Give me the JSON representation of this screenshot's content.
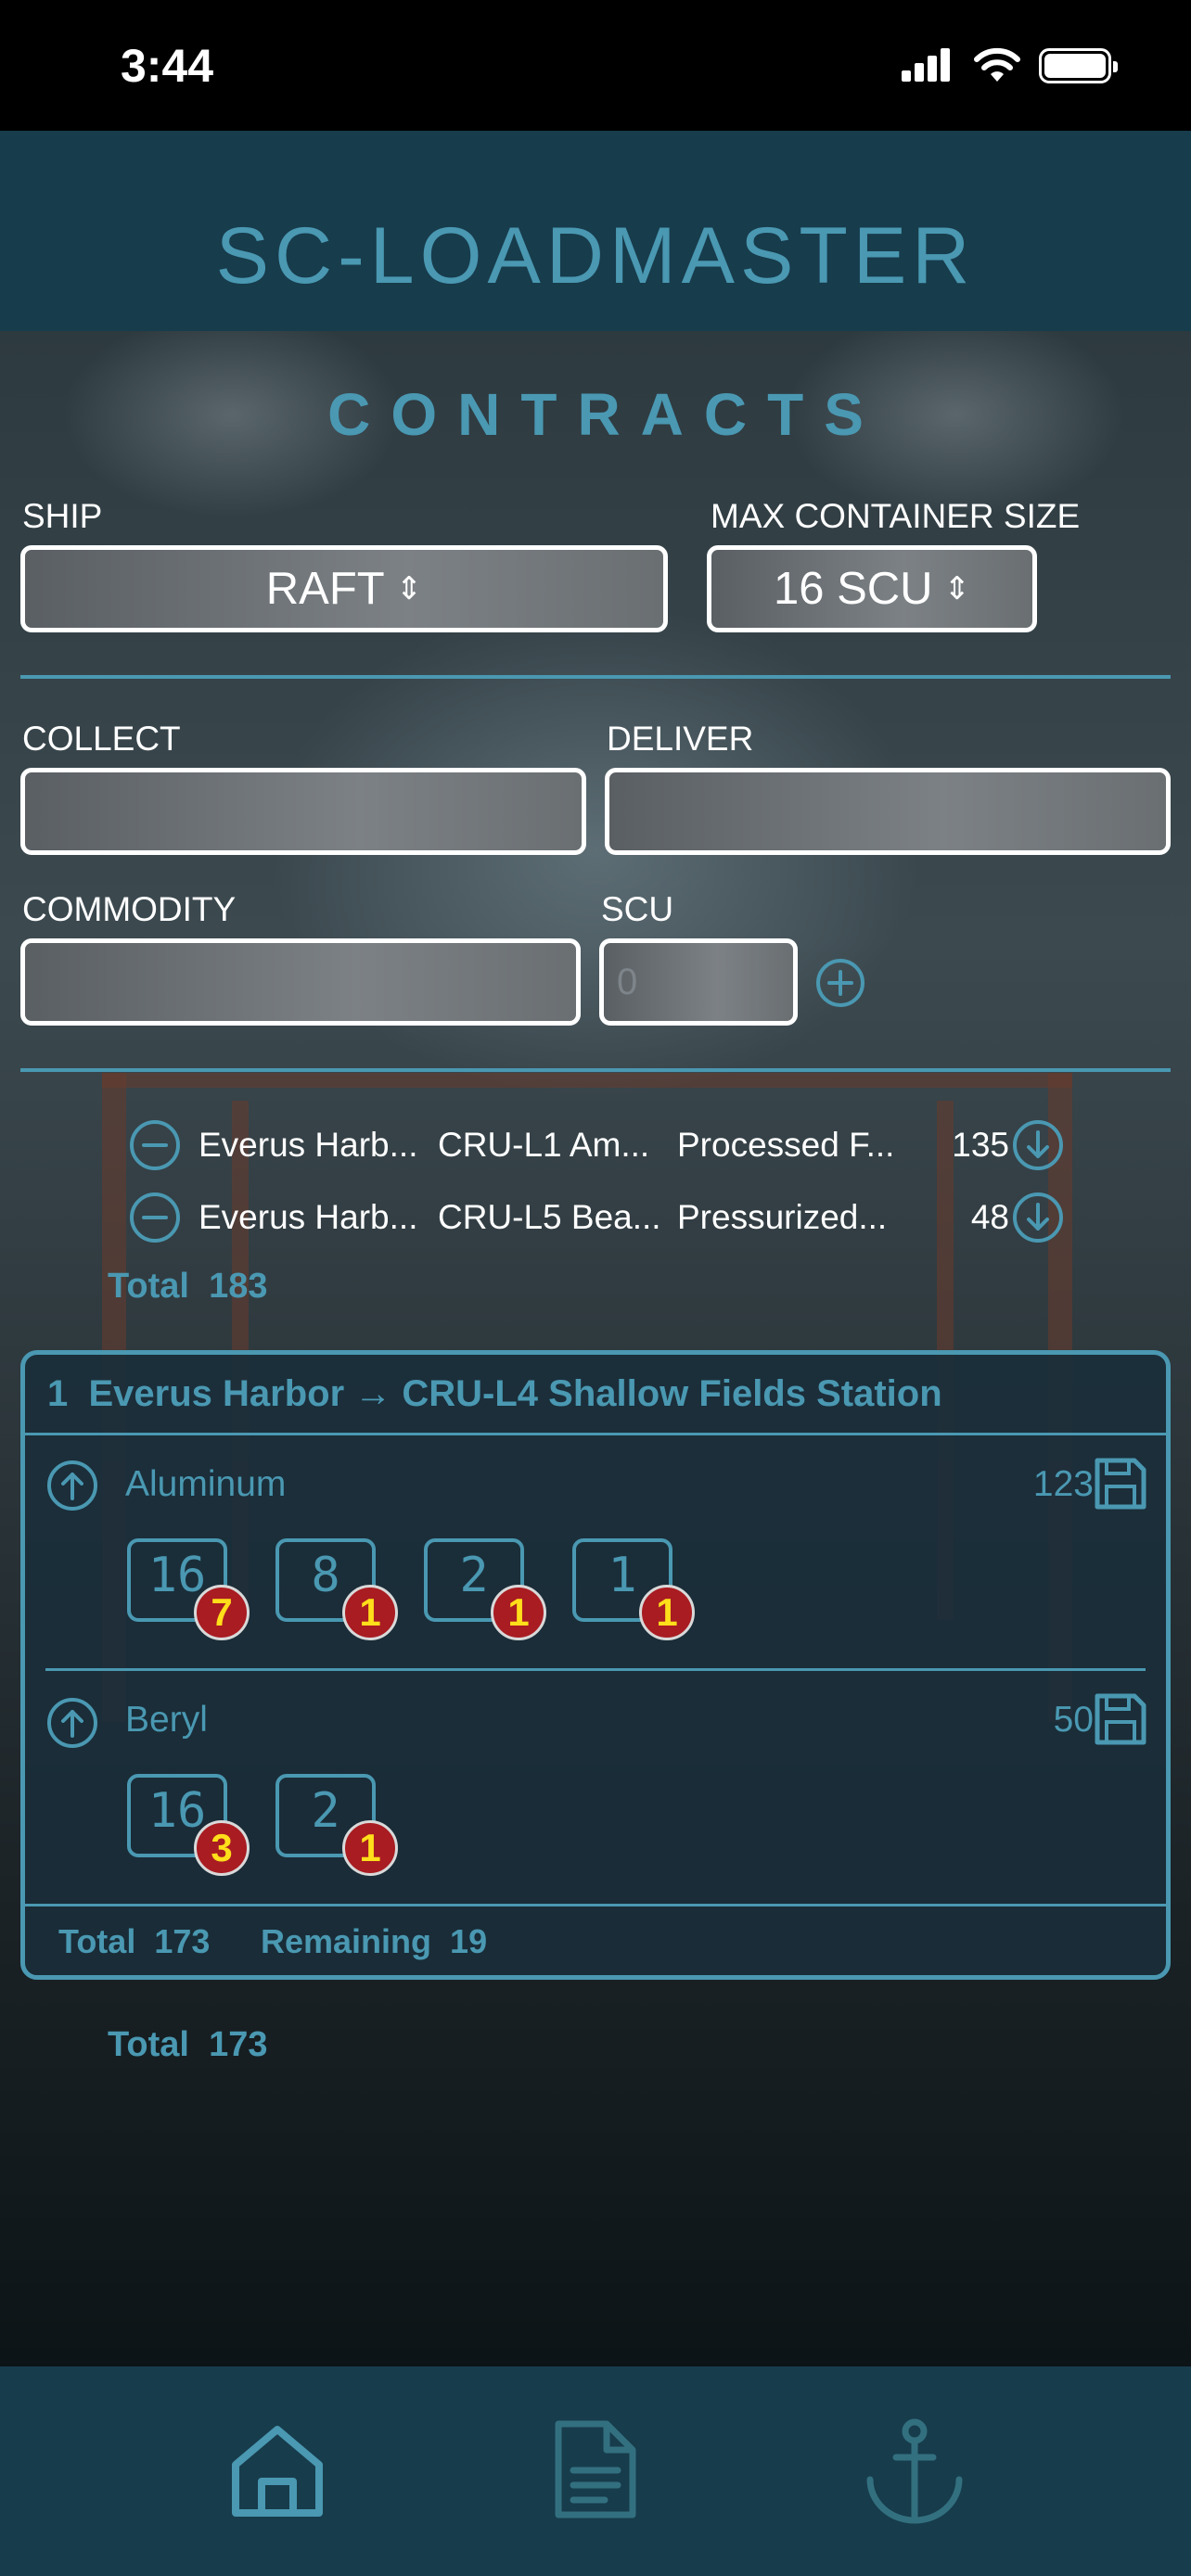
{
  "status_bar": {
    "time": "3:44"
  },
  "app": {
    "title": "SC-LOADMASTER"
  },
  "page": {
    "title": "CONTRACTS"
  },
  "form": {
    "ship_label": "SHIP",
    "ship_value": "RAFT",
    "max_container_label": "MAX CONTAINER SIZE",
    "max_container_value": "16 SCU",
    "collect_label": "COLLECT",
    "collect_value": "",
    "deliver_label": "DELIVER",
    "deliver_value": "",
    "commodity_label": "COMMODITY",
    "commodity_value": "",
    "scu_label": "SCU",
    "scu_placeholder": "0"
  },
  "contracts": [
    {
      "collect": "Everus Harb...",
      "deliver": "CRU-L1 Am...",
      "commodity": "Processed F...",
      "scu": "135"
    },
    {
      "collect": "Everus Harb...",
      "deliver": "CRU-L5 Bea...",
      "commodity": "Pressurized...",
      "scu": "48"
    }
  ],
  "contracts_total": {
    "label": "Total",
    "value": "183"
  },
  "route": {
    "index": "1",
    "title": "Everus Harbor → CRU-L4 Shallow Fields Station",
    "commodities": [
      {
        "name": "Aluminum",
        "scu": "123",
        "containers": [
          {
            "size": "16",
            "count": "7"
          },
          {
            "size": "8",
            "count": "1"
          },
          {
            "size": "2",
            "count": "1"
          },
          {
            "size": "1",
            "count": "1"
          }
        ]
      },
      {
        "name": "Beryl",
        "scu": "50",
        "containers": [
          {
            "size": "16",
            "count": "3"
          },
          {
            "size": "2",
            "count": "1"
          }
        ]
      }
    ],
    "total_label": "Total",
    "total_value": "173",
    "remaining_label": "Remaining",
    "remaining_value": "19"
  },
  "grand_total": {
    "label": "Total",
    "value": "173"
  },
  "tabs": [
    {
      "icon": "home-icon",
      "active": true
    },
    {
      "icon": "document-icon",
      "active": false
    },
    {
      "icon": "anchor-icon",
      "active": false
    }
  ],
  "colors": {
    "accent": "#4a98b2",
    "header_bg": "#173c4c",
    "badge_red": "#a81c22",
    "badge_text": "#ffde1a"
  }
}
